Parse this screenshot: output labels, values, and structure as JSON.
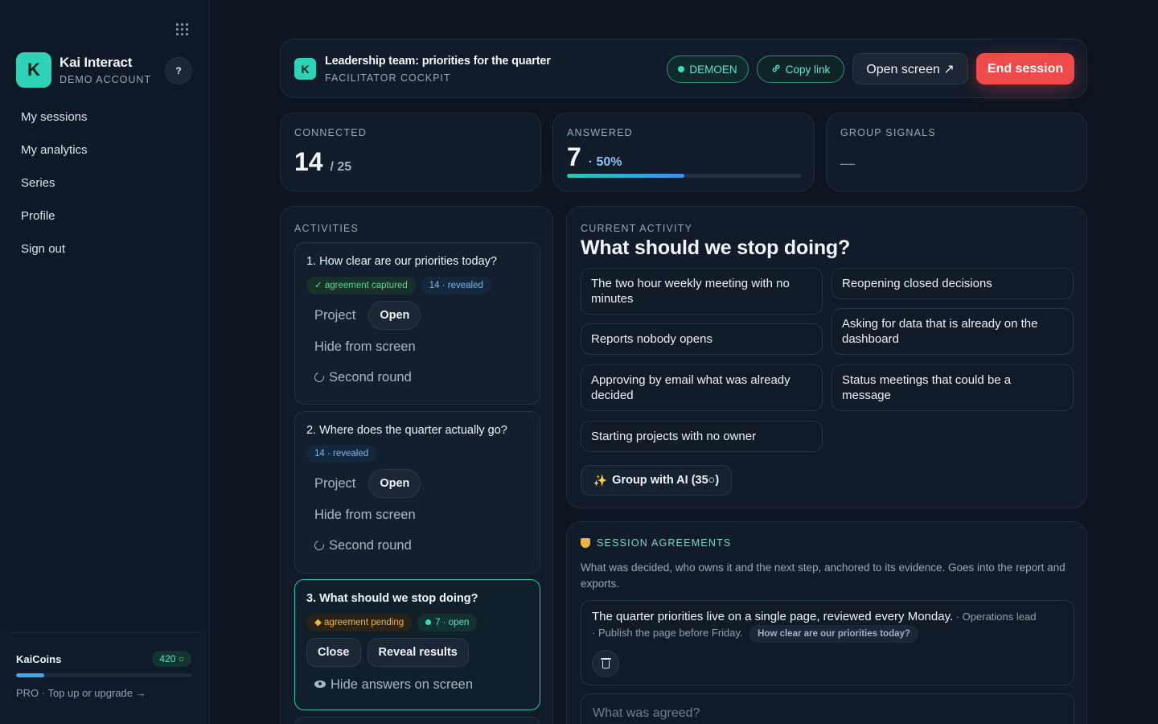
{
  "sidebar": {
    "brand_initial": "K",
    "brand_name": "Kai Interact",
    "brand_sub": "DEMO ACCOUNT",
    "help_label": "?",
    "nav": [
      "My sessions",
      "My analytics",
      "Series",
      "Profile",
      "Sign out"
    ],
    "coins": {
      "title": "KaiCoins",
      "badge": "420 ○",
      "progress_fraction": 0.16,
      "footer": "PRO · Top up or upgrade →"
    }
  },
  "header": {
    "logo_initial": "K",
    "title": "Leadership team: priorities for the quarter",
    "subtitle": "FACILITATOR COCKPIT",
    "demo_label": "DEMOEN",
    "copy_label": "Copy link",
    "open_label": "Open screen ↗",
    "end_label": "End session"
  },
  "stats": {
    "connected": {
      "label": "CONNECTED",
      "value": "14",
      "total": "/ 25"
    },
    "answered": {
      "label": "ANSWERED",
      "value": "7",
      "pct": "· 50%",
      "fraction": 0.5
    },
    "signals": {
      "label": "GROUP SIGNALS",
      "value": "—"
    }
  },
  "activities": {
    "label": "ACTIVITIES",
    "items": [
      {
        "title": "1. How clear are our priorities today?",
        "chip1": "✓ agreement captured",
        "chip2": "14 · revealed",
        "project": "Project",
        "open": "Open",
        "hide": "Hide from screen",
        "round": "Second round"
      },
      {
        "title": "2. Where does the quarter actually go?",
        "chip1": "14 · revealed",
        "project": "Project",
        "open": "Open",
        "hide": "Hide from screen",
        "round": "Second round"
      },
      {
        "title": "3. What should we stop doing?",
        "chip1": "◆ agreement pending",
        "chip2": "7 · open",
        "close": "Close",
        "reveal": "Reveal results",
        "hide": "Hide answers on screen"
      }
    ]
  },
  "current": {
    "label": "CURRENT ACTIVITY",
    "title": "What should we stop doing?",
    "answers": [
      "The two hour weekly meeting with no minutes",
      "Reopening closed decisions",
      "Reports nobody opens",
      "Asking for data that is already on the dashboard",
      "Approving by email what was already decided",
      "Status meetings that could be a message",
      "Starting projects with no owner"
    ],
    "ai_label": "Group with AI (35○)"
  },
  "agreements": {
    "label": "SESSION AGREEMENTS",
    "description": "What was decided, who owns it and the next step, anchored to its evidence. Goes into the report and exports.",
    "item": {
      "text": "The quarter priorities live on a single page, reviewed every Monday.",
      "owner": " · Operations lead",
      "next": " · Publish the page before Friday.",
      "tag": "How clear are our priorities today?"
    },
    "input_placeholder": "What was agreed?"
  },
  "colors": {
    "accent": "#2ed3b7",
    "danger": "#f04b4b",
    "background": "#0c1420"
  }
}
